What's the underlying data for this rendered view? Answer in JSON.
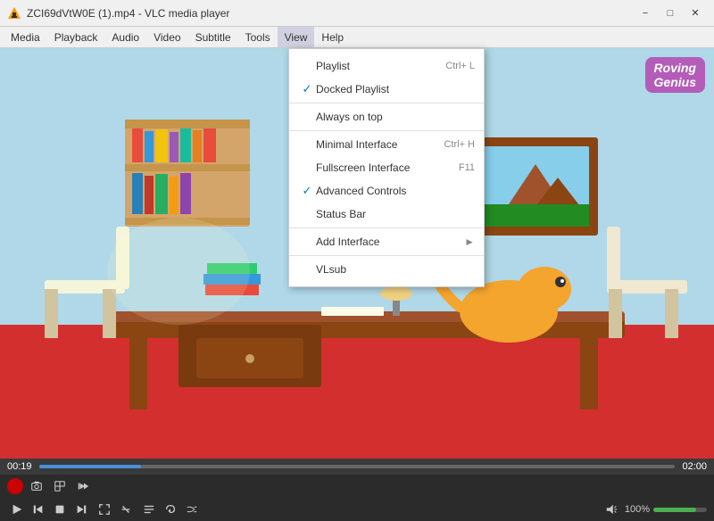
{
  "window": {
    "title": "ZCI69dVtW0E (1).mp4 - VLC media player"
  },
  "menubar": {
    "items": [
      "Media",
      "Playback",
      "Audio",
      "Video",
      "Subtitle",
      "Tools",
      "View",
      "Help"
    ]
  },
  "view_menu": {
    "sections": [
      {
        "items": [
          {
            "id": "playlist",
            "label": "Playlist",
            "shortcut": "Ctrl+ L",
            "checked": false
          },
          {
            "id": "docked-playlist",
            "label": "Docked Playlist",
            "shortcut": "",
            "checked": true
          }
        ]
      },
      {
        "items": [
          {
            "id": "always-on-top",
            "label": "Always on top",
            "shortcut": "",
            "checked": false
          }
        ]
      },
      {
        "items": [
          {
            "id": "minimal-interface",
            "label": "Minimal Interface",
            "shortcut": "Ctrl+ H",
            "checked": false
          },
          {
            "id": "fullscreen-interface",
            "label": "Fullscreen Interface",
            "shortcut": "F11",
            "checked": false
          },
          {
            "id": "advanced-controls",
            "label": "Advanced Controls",
            "shortcut": "",
            "checked": true
          },
          {
            "id": "status-bar",
            "label": "Status Bar",
            "shortcut": "",
            "checked": false
          }
        ]
      },
      {
        "items": [
          {
            "id": "add-interface",
            "label": "Add Interface",
            "shortcut": "",
            "checked": false,
            "hasArrow": true
          }
        ]
      },
      {
        "items": [
          {
            "id": "vlsub",
            "label": "VLsub",
            "shortcut": "",
            "checked": false
          }
        ]
      }
    ]
  },
  "player": {
    "time_current": "00:19",
    "time_total": "02:00",
    "volume_label": "100%",
    "progress_percent": 16
  },
  "logo": {
    "line1": "Roving",
    "line2": "Genius"
  }
}
